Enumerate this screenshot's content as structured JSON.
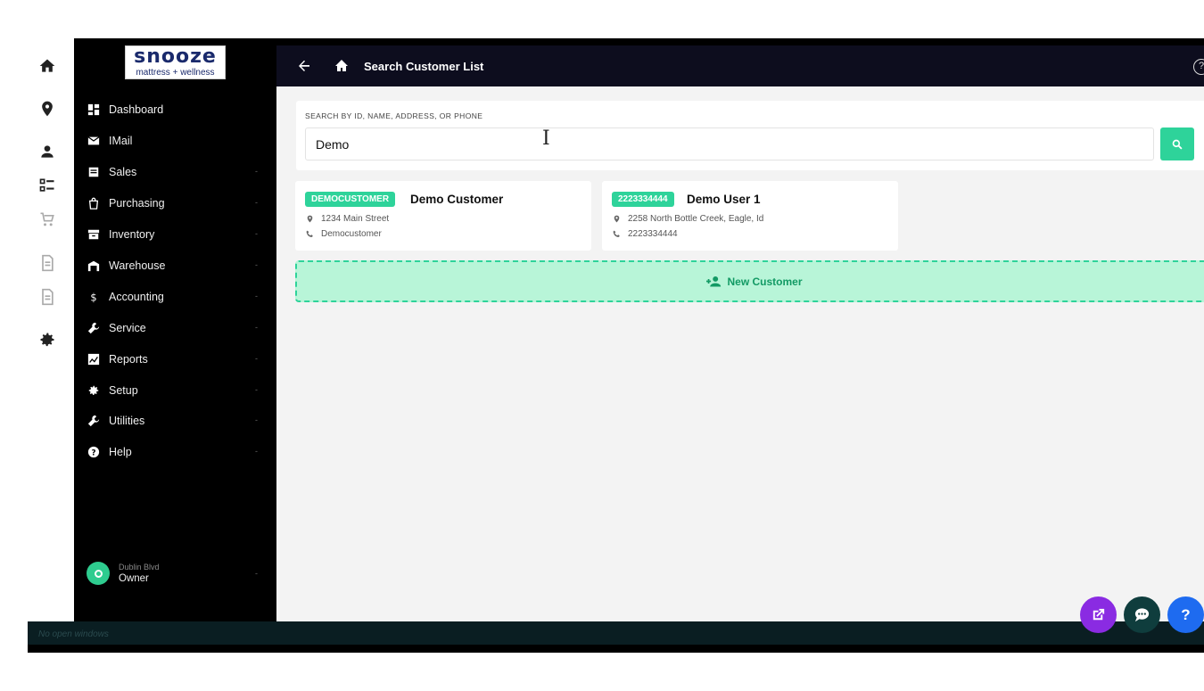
{
  "logo": {
    "line1": "snooze",
    "line2": "mattress + wellness"
  },
  "rail": {
    "icons": [
      "home-icon",
      "location-pin-icon",
      "person-icon",
      "checklist-icon",
      "cart-icon",
      "document-icon",
      "document-icon",
      "gear-icon"
    ]
  },
  "nav": {
    "items": [
      {
        "label": "Dashboard",
        "icon": "dashboard-icon"
      },
      {
        "label": "IMail",
        "icon": "mail-icon"
      },
      {
        "label": "Sales",
        "icon": "sales-icon"
      },
      {
        "label": "Purchasing",
        "icon": "bag-icon"
      },
      {
        "label": "Inventory",
        "icon": "inventory-icon"
      },
      {
        "label": "Warehouse",
        "icon": "warehouse-icon"
      },
      {
        "label": "Accounting",
        "icon": "dollar-icon"
      },
      {
        "label": "Service",
        "icon": "wrench-icon"
      },
      {
        "label": "Reports",
        "icon": "reports-icon"
      },
      {
        "label": "Setup",
        "icon": "gear-icon"
      },
      {
        "label": "Utilities",
        "icon": "wrench-icon"
      },
      {
        "label": "Help",
        "icon": "help-circle-icon"
      }
    ],
    "chevron": "-"
  },
  "user": {
    "store": "Dublin Blvd",
    "role": "Owner"
  },
  "header": {
    "title": "Search Customer List",
    "help": "?"
  },
  "search": {
    "label": "SEARCH BY ID, NAME, ADDRESS, OR PHONE",
    "value": "Demo",
    "placeholder": ""
  },
  "customers": [
    {
      "badge": "DEMOCUSTOMER",
      "name": "Demo Customer",
      "address": "1234 Main Street",
      "phone": "Democustomer"
    },
    {
      "badge": "2223334444",
      "name": "Demo User 1",
      "address": "2258 North Bottle Creek, Eagle, Id",
      "phone": "2223334444"
    }
  ],
  "new_customer": {
    "label": "New Customer"
  },
  "statusbar": {
    "text": "No open windows"
  },
  "fabs": {
    "help": "?",
    "colors": {
      "external": "#8a2be2",
      "chat": "#0f3d3d",
      "help": "#1e6bf0"
    }
  },
  "colors": {
    "accent": "#2ed39a",
    "header": "#0d0d1e",
    "sidebar": "#000000"
  }
}
